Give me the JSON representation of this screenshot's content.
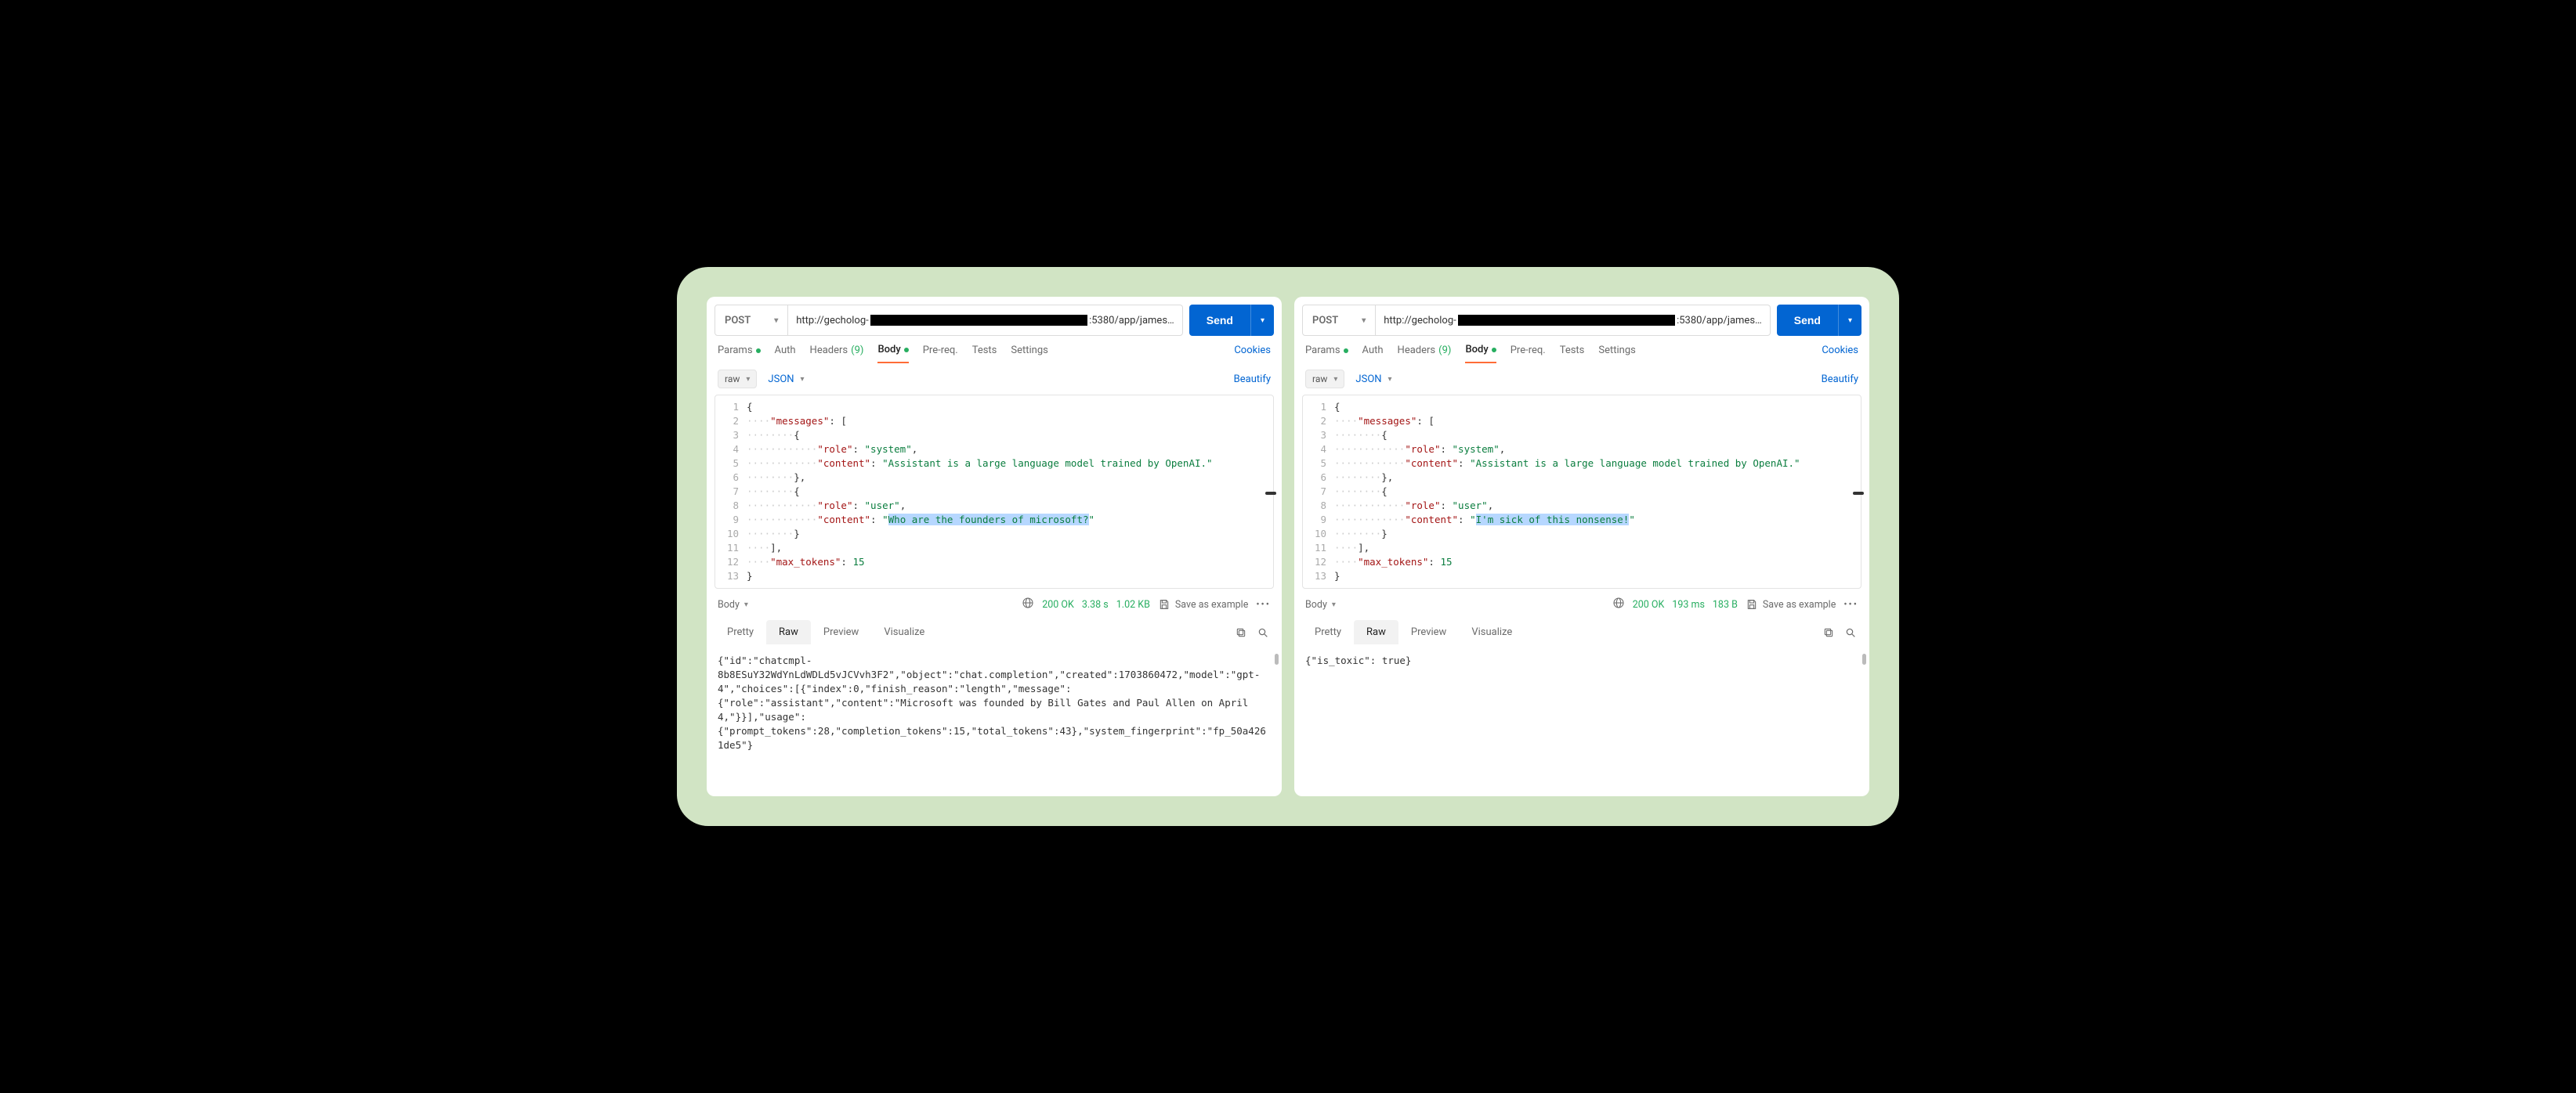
{
  "panels": [
    {
      "method": "POST",
      "url_prefix": "http://gecholog-",
      "url_suffix": ":5380/app/james…",
      "send_label": "Send",
      "tabs": {
        "params": "Params",
        "auth": "Auth",
        "headers": "Headers",
        "headers_count": "(9)",
        "body": "Body",
        "prereq": "Pre-req.",
        "tests": "Tests",
        "settings": "Settings",
        "cookies": "Cookies"
      },
      "raw_label": "raw",
      "json_label": "JSON",
      "beautify_label": "Beautify",
      "request_json": {
        "messages": [
          {
            "role": "system",
            "content": "Assistant is a large language model trained by OpenAI."
          },
          {
            "role": "user",
            "content": "Who are the founders of microsoft?"
          }
        ],
        "max_tokens": 15
      },
      "highlighted_user_content": "Who are the founders of microsoft?",
      "response_meta": {
        "body_label": "Body",
        "status": "200 OK",
        "time": "3.38 s",
        "size": "1.02 KB",
        "save_label": "Save as example"
      },
      "resp_tabs": {
        "pretty": "Pretty",
        "raw": "Raw",
        "preview": "Preview",
        "visualize": "Visualize"
      },
      "response_body": "{\"id\":\"chatcmpl-8b8ESuY32WdYnLdWDLd5vJCVvh3F2\",\"object\":\"chat.completion\",\"created\":1703860472,\"model\":\"gpt-4\",\"choices\":[{\"index\":0,\"finish_reason\":\"length\",\"message\":{\"role\":\"assistant\",\"content\":\"Microsoft was founded by Bill Gates and Paul Allen on April 4,\"}}],\"usage\":{\"prompt_tokens\":28,\"completion_tokens\":15,\"total_tokens\":43},\"system_fingerprint\":\"fp_50a4261de5\"}"
    },
    {
      "method": "POST",
      "url_prefix": "http://gecholog-",
      "url_suffix": ":5380/app/james…",
      "send_label": "Send",
      "tabs": {
        "params": "Params",
        "auth": "Auth",
        "headers": "Headers",
        "headers_count": "(9)",
        "body": "Body",
        "prereq": "Pre-req.",
        "tests": "Tests",
        "settings": "Settings",
        "cookies": "Cookies"
      },
      "raw_label": "raw",
      "json_label": "JSON",
      "beautify_label": "Beautify",
      "request_json": {
        "messages": [
          {
            "role": "system",
            "content": "Assistant is a large language model trained by OpenAI."
          },
          {
            "role": "user",
            "content": "I'm sick of this nonsense!"
          }
        ],
        "max_tokens": 15
      },
      "highlighted_user_content": "I'm sick of this nonsense!",
      "response_meta": {
        "body_label": "Body",
        "status": "200 OK",
        "time": "193 ms",
        "size": "183 B",
        "save_label": "Save as example"
      },
      "resp_tabs": {
        "pretty": "Pretty",
        "raw": "Raw",
        "preview": "Preview",
        "visualize": "Visualize"
      },
      "response_body": "{\"is_toxic\": true}"
    }
  ]
}
